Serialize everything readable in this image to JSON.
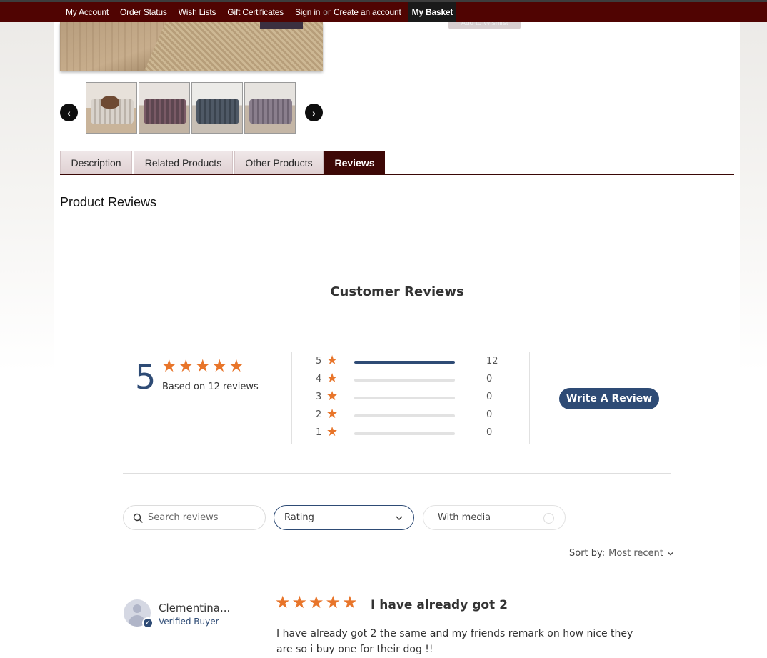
{
  "nav": {
    "my_account": "My Account",
    "order_status": "Order Status",
    "wish_lists": "Wish Lists",
    "gift_certificates": "Gift Certificates",
    "sign_in": "Sign in",
    "or": "or",
    "create_account": "Create an account",
    "my_basket": "My Basket"
  },
  "product": {
    "add_to_wishlist": "Add to Wishlist"
  },
  "tabs": [
    {
      "label": "Description"
    },
    {
      "label": "Related Products"
    },
    {
      "label": "Other Products"
    },
    {
      "label": "Reviews"
    }
  ],
  "product_reviews_title": "Product Reviews",
  "reviews_widget": {
    "title": "Customer Reviews",
    "average": "5",
    "based_on": "Based on 12 reviews",
    "histogram": [
      {
        "stars": "5",
        "count": "12",
        "fraction": 1.0
      },
      {
        "stars": "4",
        "count": "0",
        "fraction": 0
      },
      {
        "stars": "3",
        "count": "0",
        "fraction": 0
      },
      {
        "stars": "2",
        "count": "0",
        "fraction": 0
      },
      {
        "stars": "1",
        "count": "0",
        "fraction": 0
      }
    ],
    "write_review": "Write A Review",
    "search_placeholder": "Search reviews",
    "rating_filter": "Rating",
    "with_media": "With media",
    "sort_label": "Sort by:",
    "sort_value": "Most recent"
  },
  "review": {
    "author": "Clementina...",
    "verified": "Verified Buyer",
    "rating": 5,
    "title": "I have already got 2",
    "body": "I have already got 2 the same and my friends remark on how nice they are so i buy one for their dog !!"
  },
  "colors": {
    "header_bg": "#500402",
    "active_tab": "#3d0806",
    "accent_blue": "#2e4b75",
    "star": "#e8752a"
  }
}
